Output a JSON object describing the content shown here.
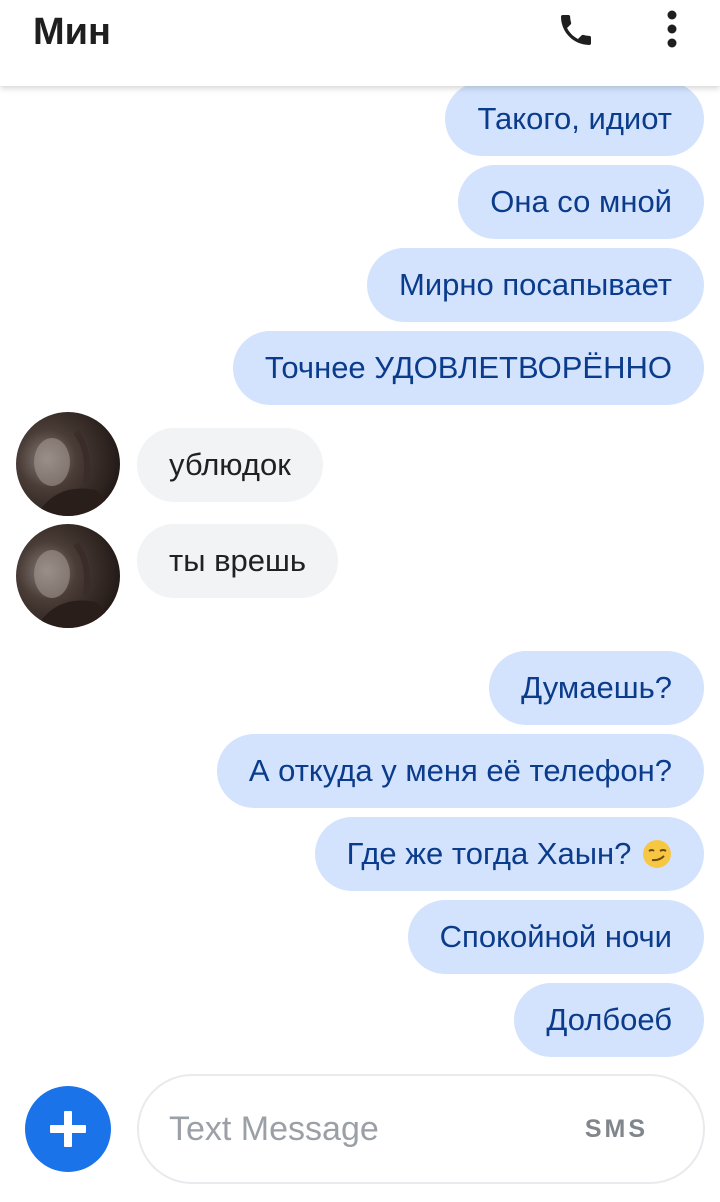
{
  "header": {
    "title": "Мин",
    "call_icon": "phone-icon",
    "more_icon": "more-vert-icon"
  },
  "messages": [
    {
      "dir": "out",
      "text": "Такого, идиот"
    },
    {
      "dir": "out",
      "text": "Она со мной"
    },
    {
      "dir": "out",
      "text": "Мирно посапывает"
    },
    {
      "dir": "out",
      "text": "Точнее УДОВЛЕТВОРЁННО"
    },
    {
      "dir": "in",
      "text": "ублюдок"
    },
    {
      "dir": "in",
      "text": "ты врешь"
    },
    {
      "dir": "out",
      "text": "Думаешь?"
    },
    {
      "dir": "out",
      "text": "А откуда у меня её телефон?"
    },
    {
      "dir": "out",
      "text": "Где же тогда Хаын?",
      "emoji": "smirking-face"
    },
    {
      "dir": "out",
      "text": "Спокойной ночи"
    },
    {
      "dir": "out",
      "text": "Долбоеб"
    }
  ],
  "composer": {
    "placeholder": "Text Message",
    "mode_label": "SMS",
    "add_icon": "plus-icon"
  },
  "colors": {
    "outgoing_bubble": "#d3e3fd",
    "outgoing_text": "#0b3c8c",
    "incoming_bubble": "#f1f3f4",
    "incoming_text": "#202124",
    "fab": "#1a73e8"
  }
}
